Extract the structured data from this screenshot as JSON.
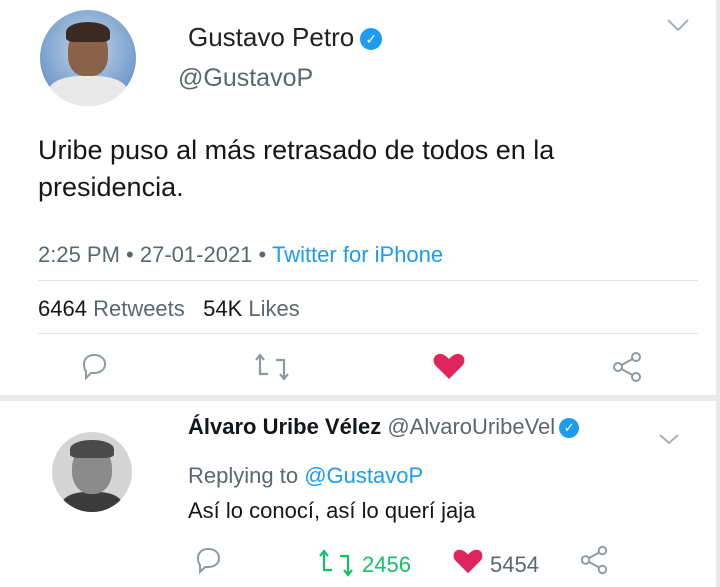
{
  "tweet": {
    "author_name": "Gustavo Petro",
    "author_handle": "@GustavoP",
    "text_line1": "Uribe puso al más retrasado de todos en la",
    "text_line2": "presidencia.",
    "time": "2:25 PM",
    "date": "27-01-2021",
    "source": "Twitter for iPhone",
    "retweets_count": "6464",
    "retweets_label": "Retweets",
    "likes_count": "54K",
    "likes_label": "Likes"
  },
  "reply": {
    "author_name": "Álvaro Uribe Vélez",
    "author_handle": "@AlvaroUribeVel",
    "replying_prefix": "Replying to",
    "replying_to": "@GustavoP",
    "text": "Así lo conocí, así lo querí jaja",
    "retweets": "2456",
    "likes": "5454"
  },
  "icons": {
    "reply": "reply-icon",
    "retweet": "retweet-icon",
    "like": "heart-icon",
    "share": "share-icon",
    "more": "chevron-down-icon",
    "verified": "verified-badge-icon"
  },
  "colors": {
    "accent": "#1d9bf0",
    "like": "#e0245e",
    "retweet": "#17bf63"
  }
}
